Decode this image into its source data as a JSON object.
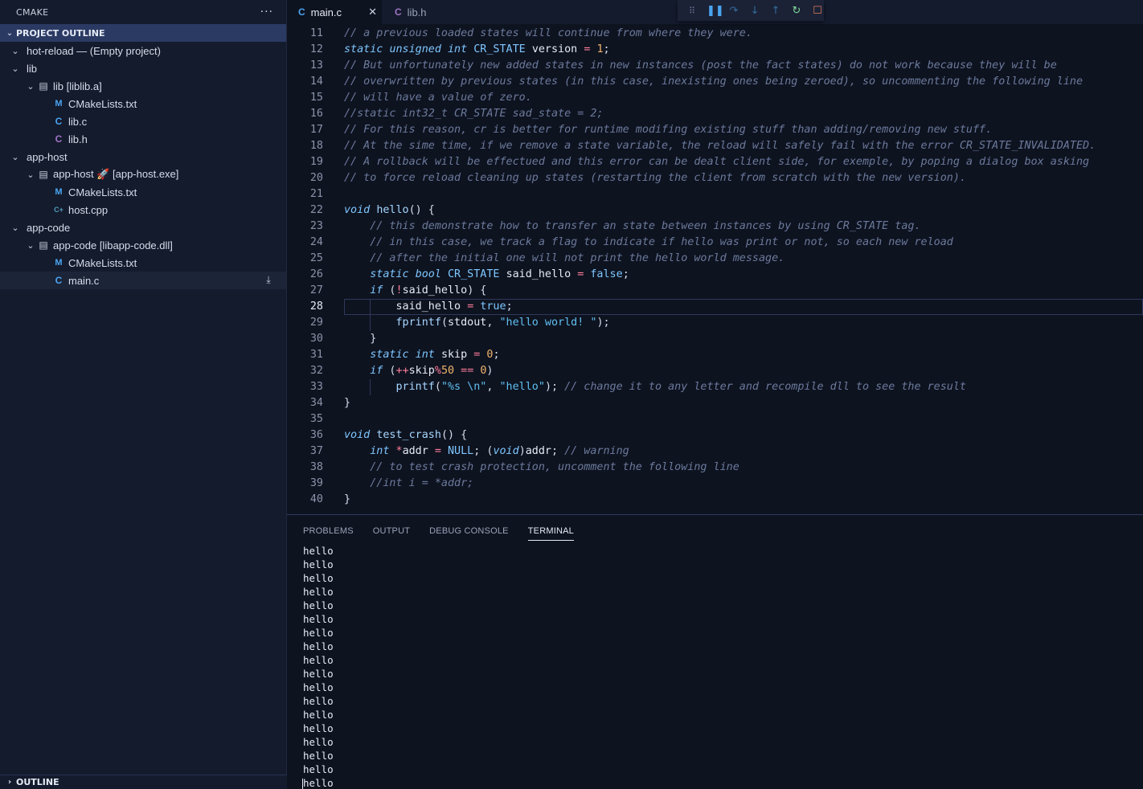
{
  "sidebar": {
    "header_title": "CMAKE",
    "more_label": "···",
    "section_title": "PROJECT OUTLINE",
    "bottom_section_title": "OUTLINE",
    "tree": [
      {
        "label": "hot-reload — (Empty project)",
        "depth": 0,
        "twisty": "open",
        "icon": ""
      },
      {
        "label": "lib",
        "depth": 0,
        "twisty": "open",
        "icon": ""
      },
      {
        "label": "lib [liblib.a]",
        "depth": 1,
        "twisty": "open",
        "icon": "library-icon"
      },
      {
        "label": "CMakeLists.txt",
        "depth": 2,
        "twisty": "",
        "icon": "cmake-icon"
      },
      {
        "label": "lib.c",
        "depth": 2,
        "twisty": "",
        "icon": "c-file-icon"
      },
      {
        "label": "lib.h",
        "depth": 2,
        "twisty": "",
        "icon": "c-header-icon"
      },
      {
        "label": "app-host",
        "depth": 0,
        "twisty": "open",
        "icon": ""
      },
      {
        "label": "app-host 🚀 [app-host.exe]",
        "depth": 1,
        "twisty": "open",
        "icon": "library-icon"
      },
      {
        "label": "CMakeLists.txt",
        "depth": 2,
        "twisty": "",
        "icon": "cmake-icon"
      },
      {
        "label": "host.cpp",
        "depth": 2,
        "twisty": "",
        "icon": "cpp-file-icon"
      },
      {
        "label": "app-code",
        "depth": 0,
        "twisty": "open",
        "icon": ""
      },
      {
        "label": "app-code [libapp-code.dll]",
        "depth": 1,
        "twisty": "open",
        "icon": "library-icon"
      },
      {
        "label": "CMakeLists.txt",
        "depth": 2,
        "twisty": "",
        "icon": "cmake-icon"
      },
      {
        "label": "main.c",
        "depth": 2,
        "twisty": "",
        "icon": "c-file-icon"
      }
    ]
  },
  "tabs": [
    {
      "label": "main.c",
      "active": true
    },
    {
      "label": "lib.h",
      "active": false
    }
  ],
  "editor": {
    "current_line": 28,
    "lines": [
      {
        "n": "11",
        "text": "// a previous loaded states will continue from where they were."
      },
      {
        "n": "12",
        "text": "static unsigned int CR_STATE version = 1;"
      },
      {
        "n": "13",
        "text": "// But unfortunately new added states in new instances (post the fact states) do not work because they will be"
      },
      {
        "n": "14",
        "text": "// overwritten by previous states (in this case, inexisting ones being zeroed), so uncommenting the following line"
      },
      {
        "n": "15",
        "text": "// will have a value of zero."
      },
      {
        "n": "16",
        "text": "//static int32_t CR_STATE sad_state = 2;"
      },
      {
        "n": "17",
        "text": "// For this reason, cr is better for runtime modifing existing stuff than adding/removing new stuff."
      },
      {
        "n": "18",
        "text": "// At the sime time, if we remove a state variable, the reload will safely fail with the error CR_STATE_INVALIDATED."
      },
      {
        "n": "19",
        "text": "// A rollback will be effectued and this error can be dealt client side, for exemple, by poping a dialog box asking"
      },
      {
        "n": "20",
        "text": "// to force reload cleaning up states (restarting the client from scratch with the new version)."
      },
      {
        "n": "21",
        "text": ""
      },
      {
        "n": "22",
        "text": "void hello() {"
      },
      {
        "n": "23",
        "text": "    // this demonstrate how to transfer an state between instances by using CR_STATE tag."
      },
      {
        "n": "24",
        "text": "    // in this case, we track a flag to indicate if hello was print or not, so each new reload"
      },
      {
        "n": "25",
        "text": "    // after the initial one will not print the hello world message."
      },
      {
        "n": "26",
        "text": "    static bool CR_STATE said_hello = false;"
      },
      {
        "n": "27",
        "text": "    if (!said_hello) {"
      },
      {
        "n": "28",
        "text": "        said_hello = true;"
      },
      {
        "n": "29",
        "text": "        fprintf(stdout, \"hello world! \");"
      },
      {
        "n": "30",
        "text": "    }"
      },
      {
        "n": "31",
        "text": "    static int skip = 0;"
      },
      {
        "n": "32",
        "text": "    if (++skip%50 == 0)"
      },
      {
        "n": "33",
        "text": "        printf(\"%s \\n\", \"hello\"); // change it to any letter and recompile dll to see the result"
      },
      {
        "n": "34",
        "text": "}"
      },
      {
        "n": "35",
        "text": ""
      },
      {
        "n": "36",
        "text": "void test_crash() {"
      },
      {
        "n": "37",
        "text": "    int *addr = NULL; (void)addr; // warning"
      },
      {
        "n": "38",
        "text": "    // to test crash protection, uncomment the following line"
      },
      {
        "n": "39",
        "text": "    //int i = *addr;"
      },
      {
        "n": "40",
        "text": "}"
      }
    ]
  },
  "panel": {
    "tabs": [
      {
        "label": "PROBLEMS",
        "active": false
      },
      {
        "label": "OUTPUT",
        "active": false
      },
      {
        "label": "DEBUG CONSOLE",
        "active": false
      },
      {
        "label": "TERMINAL",
        "active": true
      }
    ],
    "terminal_lines": [
      "hello",
      "hello",
      "hello",
      "hello",
      "hello",
      "hello",
      "hello",
      "hello",
      "hello",
      "hello",
      "hello",
      "hello",
      "hello",
      "hello",
      "hello",
      "hello",
      "hello",
      "hello"
    ]
  },
  "debug_toolbar": {
    "icons": [
      "drag-grip-icon",
      "pause-icon",
      "step-over-icon",
      "step-into-icon",
      "step-out-icon",
      "restart-icon",
      "stop-icon"
    ]
  }
}
